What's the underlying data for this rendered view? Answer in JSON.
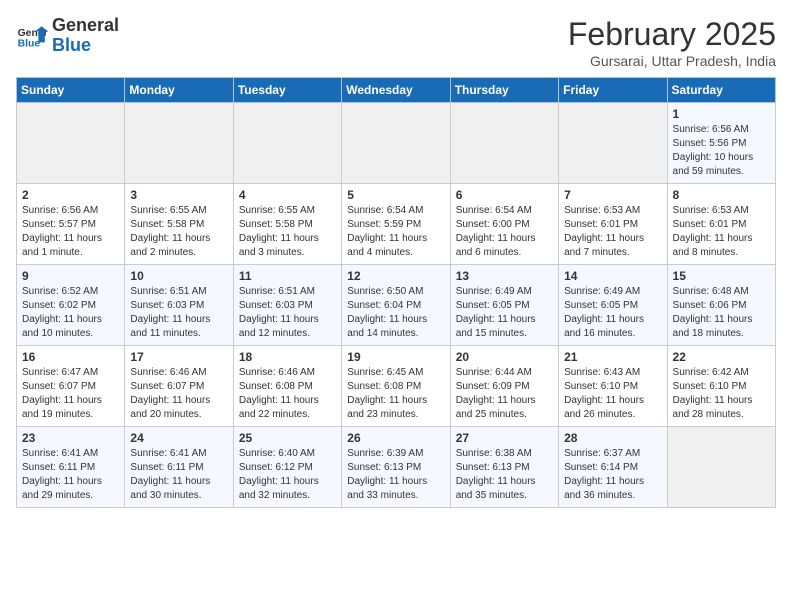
{
  "header": {
    "logo_line1": "General",
    "logo_line2": "Blue",
    "month_title": "February 2025",
    "subtitle": "Gursarai, Uttar Pradesh, India"
  },
  "days_of_week": [
    "Sunday",
    "Monday",
    "Tuesday",
    "Wednesday",
    "Thursday",
    "Friday",
    "Saturday"
  ],
  "weeks": [
    [
      {
        "day": "",
        "info": ""
      },
      {
        "day": "",
        "info": ""
      },
      {
        "day": "",
        "info": ""
      },
      {
        "day": "",
        "info": ""
      },
      {
        "day": "",
        "info": ""
      },
      {
        "day": "",
        "info": ""
      },
      {
        "day": "1",
        "info": "Sunrise: 6:56 AM\nSunset: 5:56 PM\nDaylight: 10 hours and 59 minutes."
      }
    ],
    [
      {
        "day": "2",
        "info": "Sunrise: 6:56 AM\nSunset: 5:57 PM\nDaylight: 11 hours and 1 minute."
      },
      {
        "day": "3",
        "info": "Sunrise: 6:55 AM\nSunset: 5:58 PM\nDaylight: 11 hours and 2 minutes."
      },
      {
        "day": "4",
        "info": "Sunrise: 6:55 AM\nSunset: 5:58 PM\nDaylight: 11 hours and 3 minutes."
      },
      {
        "day": "5",
        "info": "Sunrise: 6:54 AM\nSunset: 5:59 PM\nDaylight: 11 hours and 4 minutes."
      },
      {
        "day": "6",
        "info": "Sunrise: 6:54 AM\nSunset: 6:00 PM\nDaylight: 11 hours and 6 minutes."
      },
      {
        "day": "7",
        "info": "Sunrise: 6:53 AM\nSunset: 6:01 PM\nDaylight: 11 hours and 7 minutes."
      },
      {
        "day": "8",
        "info": "Sunrise: 6:53 AM\nSunset: 6:01 PM\nDaylight: 11 hours and 8 minutes."
      }
    ],
    [
      {
        "day": "9",
        "info": "Sunrise: 6:52 AM\nSunset: 6:02 PM\nDaylight: 11 hours and 10 minutes."
      },
      {
        "day": "10",
        "info": "Sunrise: 6:51 AM\nSunset: 6:03 PM\nDaylight: 11 hours and 11 minutes."
      },
      {
        "day": "11",
        "info": "Sunrise: 6:51 AM\nSunset: 6:03 PM\nDaylight: 11 hours and 12 minutes."
      },
      {
        "day": "12",
        "info": "Sunrise: 6:50 AM\nSunset: 6:04 PM\nDaylight: 11 hours and 14 minutes."
      },
      {
        "day": "13",
        "info": "Sunrise: 6:49 AM\nSunset: 6:05 PM\nDaylight: 11 hours and 15 minutes."
      },
      {
        "day": "14",
        "info": "Sunrise: 6:49 AM\nSunset: 6:05 PM\nDaylight: 11 hours and 16 minutes."
      },
      {
        "day": "15",
        "info": "Sunrise: 6:48 AM\nSunset: 6:06 PM\nDaylight: 11 hours and 18 minutes."
      }
    ],
    [
      {
        "day": "16",
        "info": "Sunrise: 6:47 AM\nSunset: 6:07 PM\nDaylight: 11 hours and 19 minutes."
      },
      {
        "day": "17",
        "info": "Sunrise: 6:46 AM\nSunset: 6:07 PM\nDaylight: 11 hours and 20 minutes."
      },
      {
        "day": "18",
        "info": "Sunrise: 6:46 AM\nSunset: 6:08 PM\nDaylight: 11 hours and 22 minutes."
      },
      {
        "day": "19",
        "info": "Sunrise: 6:45 AM\nSunset: 6:08 PM\nDaylight: 11 hours and 23 minutes."
      },
      {
        "day": "20",
        "info": "Sunrise: 6:44 AM\nSunset: 6:09 PM\nDaylight: 11 hours and 25 minutes."
      },
      {
        "day": "21",
        "info": "Sunrise: 6:43 AM\nSunset: 6:10 PM\nDaylight: 11 hours and 26 minutes."
      },
      {
        "day": "22",
        "info": "Sunrise: 6:42 AM\nSunset: 6:10 PM\nDaylight: 11 hours and 28 minutes."
      }
    ],
    [
      {
        "day": "23",
        "info": "Sunrise: 6:41 AM\nSunset: 6:11 PM\nDaylight: 11 hours and 29 minutes."
      },
      {
        "day": "24",
        "info": "Sunrise: 6:41 AM\nSunset: 6:11 PM\nDaylight: 11 hours and 30 minutes."
      },
      {
        "day": "25",
        "info": "Sunrise: 6:40 AM\nSunset: 6:12 PM\nDaylight: 11 hours and 32 minutes."
      },
      {
        "day": "26",
        "info": "Sunrise: 6:39 AM\nSunset: 6:13 PM\nDaylight: 11 hours and 33 minutes."
      },
      {
        "day": "27",
        "info": "Sunrise: 6:38 AM\nSunset: 6:13 PM\nDaylight: 11 hours and 35 minutes."
      },
      {
        "day": "28",
        "info": "Sunrise: 6:37 AM\nSunset: 6:14 PM\nDaylight: 11 hours and 36 minutes."
      },
      {
        "day": "",
        "info": ""
      }
    ]
  ]
}
